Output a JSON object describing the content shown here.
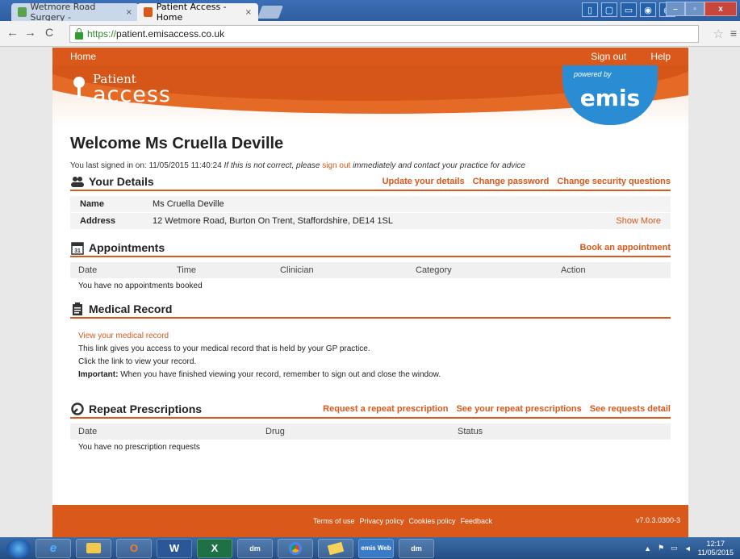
{
  "browser": {
    "tabs": [
      {
        "title": "Wetmore Road Surgery -",
        "active": false
      },
      {
        "title": "Patient Access - Home",
        "active": true
      }
    ],
    "tab_close": "×",
    "url_scheme": "https://",
    "url_host": "patient.emisaccess.co.uk"
  },
  "nav": {
    "home": "Home",
    "sign_out": "Sign out",
    "help": "Help"
  },
  "logo": {
    "line1": "Patient",
    "line2": "access",
    "powered_by": "powered by",
    "brand": "emis"
  },
  "welcome": {
    "title": "Welcome Ms Cruella Deville",
    "last_signed_prefix": "You last signed in on: 11/05/2015 11:40:24",
    "warning_prefix": "If this is not correct, please",
    "sign_out_link": "sign out",
    "warning_suffix": "immediately and contact your practice for advice"
  },
  "details": {
    "title": "Your Details",
    "links": [
      "Update your details",
      "Change password",
      "Change security questions"
    ],
    "name_label": "Name",
    "name_value": "Ms Cruella Deville",
    "address_label": "Address",
    "address_value": "12 Wetmore Road, Burton On Trent, Staffordshire, DE14 1SL",
    "show_more": "Show More"
  },
  "appointments": {
    "title": "Appointments",
    "link": "Book an appointment",
    "columns": [
      "Date",
      "Time",
      "Clinician",
      "Category",
      "Action"
    ],
    "empty": "You have no appointments booked",
    "calendar_day": "31"
  },
  "medical": {
    "title": "Medical Record",
    "link": "View your medical record",
    "line1": "This link gives you access to your medical record that is held by your GP practice.",
    "line2": "Click the link to view your record.",
    "important_label": "Important:",
    "important_text": "When you have finished viewing your record, remember to sign out and close the window."
  },
  "prescriptions": {
    "title": "Repeat Prescriptions",
    "links": [
      "Request a repeat prescription",
      "See your repeat prescriptions",
      "See requests detail"
    ],
    "columns": [
      "Date",
      "Drug",
      "Status"
    ],
    "empty": "You have no prescription requests"
  },
  "footer": {
    "links": [
      "Terms of use",
      "Privacy policy",
      "Cookies policy",
      "Feedback"
    ],
    "version": "v7.0.3.0300-3"
  },
  "taskbar": {
    "items": [
      "e",
      "",
      "O",
      "W",
      "X",
      "dm",
      "",
      "",
      "emis Web",
      "dm"
    ],
    "time": "12:17",
    "date": "11/05/2015"
  },
  "colors": {
    "brand_orange": "#d9581a",
    "emis_blue": "#2a8dd4"
  }
}
